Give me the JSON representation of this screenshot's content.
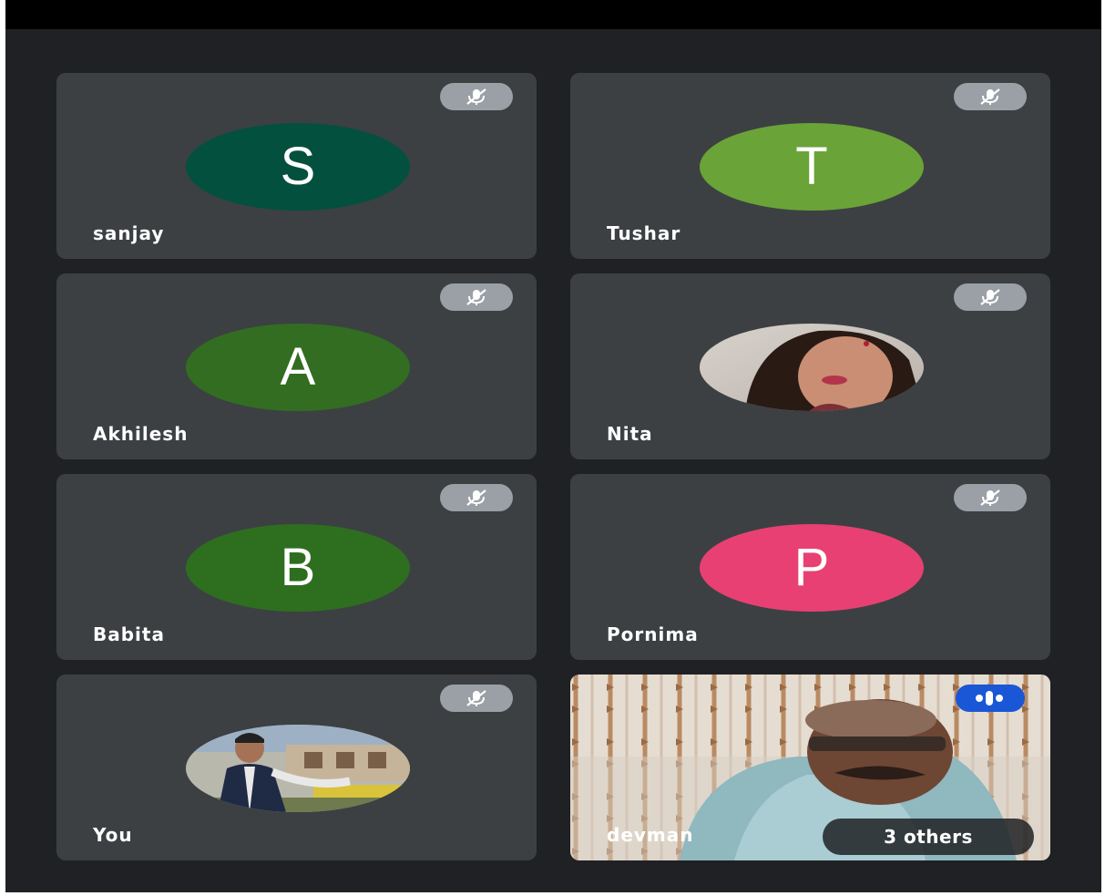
{
  "participants": [
    {
      "name": "sanjay",
      "initial": "S",
      "color": "#03503f",
      "muted": true,
      "type": "initial"
    },
    {
      "name": "Tushar",
      "initial": "T",
      "color": "#6aa337",
      "muted": true,
      "type": "initial"
    },
    {
      "name": "Akhilesh",
      "initial": "A",
      "color": "#326d21",
      "muted": true,
      "type": "initial"
    },
    {
      "name": "Nita",
      "initial": "",
      "color": "#c9c3bd",
      "muted": true,
      "type": "photo"
    },
    {
      "name": "Babita",
      "initial": "B",
      "color": "#2e6f1f",
      "muted": true,
      "type": "initial"
    },
    {
      "name": "Pornima",
      "initial": "P",
      "color": "#e84073",
      "muted": true,
      "type": "initial"
    },
    {
      "name": "You",
      "initial": "",
      "color": "#8a7a5e",
      "muted": true,
      "type": "photo"
    },
    {
      "name": "devman",
      "initial": "",
      "color": "#c7b29a",
      "muted": false,
      "type": "video",
      "speaking": true
    }
  ],
  "others_label": "3 others",
  "icons": {
    "muted": "mic-off-icon",
    "speaking": "audio-level-icon"
  },
  "colors": {
    "background": "#202124",
    "tile": "#3c4043",
    "mute_badge": "#9aa0a6",
    "speaking_badge": "#1a57d6"
  }
}
